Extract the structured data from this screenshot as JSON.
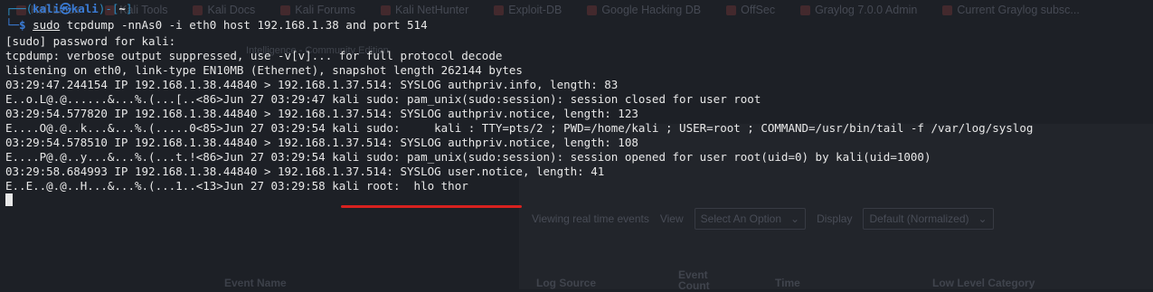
{
  "background": {
    "bookmarks": [
      "Kali Linux",
      "Kali Tools",
      "Kali Docs",
      "Kali Forums",
      "Kali NetHunter",
      "Exploit-DB",
      "Google Hacking DB",
      "OffSec",
      "Graylog 7.0.0 Admin",
      "Current Graylog subsc..."
    ],
    "subtitle": "Intelligence - Community Edition",
    "viewing_label": "Viewing real time events",
    "view_label": "View",
    "view_select": "Select An Option",
    "display_label": "Display",
    "display_select": "Default (Normalized)",
    "columns": [
      "Event Name",
      "Log Source",
      "Event Count",
      "Time",
      "Low Level Category"
    ]
  },
  "terminal": {
    "prompt": {
      "top_left": "┌──(",
      "user": "kali㉿kali",
      "top_mid": ")-[",
      "path": "~",
      "top_right": "]",
      "bottom": "└─$ ",
      "sudo": "sudo",
      "command": " tcpdump -nnAs0 -i eth0 host 192.168.1.38 and port 514"
    },
    "lines": [
      "[sudo] password for kali:",
      "tcpdump: verbose output suppressed, use -v[v]... for full protocol decode",
      "listening on eth0, link-type EN10MB (Ethernet), snapshot length 262144 bytes",
      "03:29:47.244154 IP 192.168.1.38.44840 > 192.168.1.37.514: SYSLOG authpriv.info, length: 83",
      "E..o.L@.@......&...%.(...[..<86>Jun 27 03:29:47 kali sudo: pam_unix(sudo:session): session closed for user root",
      "03:29:54.577820 IP 192.168.1.38.44840 > 192.168.1.37.514: SYSLOG authpriv.notice, length: 123",
      "E....O@.@..k...&...%.(.....0<85>Jun 27 03:29:54 kali sudo:     kali : TTY=pts/2 ; PWD=/home/kali ; USER=root ; COMMAND=/usr/bin/tail -f /var/log/syslog",
      "03:29:54.578510 IP 192.168.1.38.44840 > 192.168.1.37.514: SYSLOG authpriv.notice, length: 108",
      "E....P@.@..y...&...%.(...t.!<86>Jun 27 03:29:54 kali sudo: pam_unix(sudo:session): session opened for user root(uid=0) by kali(uid=1000)",
      "03:29:58.684993 IP 192.168.1.38.44840 > 192.168.1.37.514: SYSLOG user.notice, length: 41",
      "E..E..@.@..H...&...%.(...1..<13>Jun 27 03:29:58 kali root:  hlo thor"
    ]
  },
  "colors": {
    "background": "#1d2026",
    "prompt_blue": "#3a7bd5",
    "text": "#e8e8e8",
    "annotation_red": "#d7211f"
  }
}
